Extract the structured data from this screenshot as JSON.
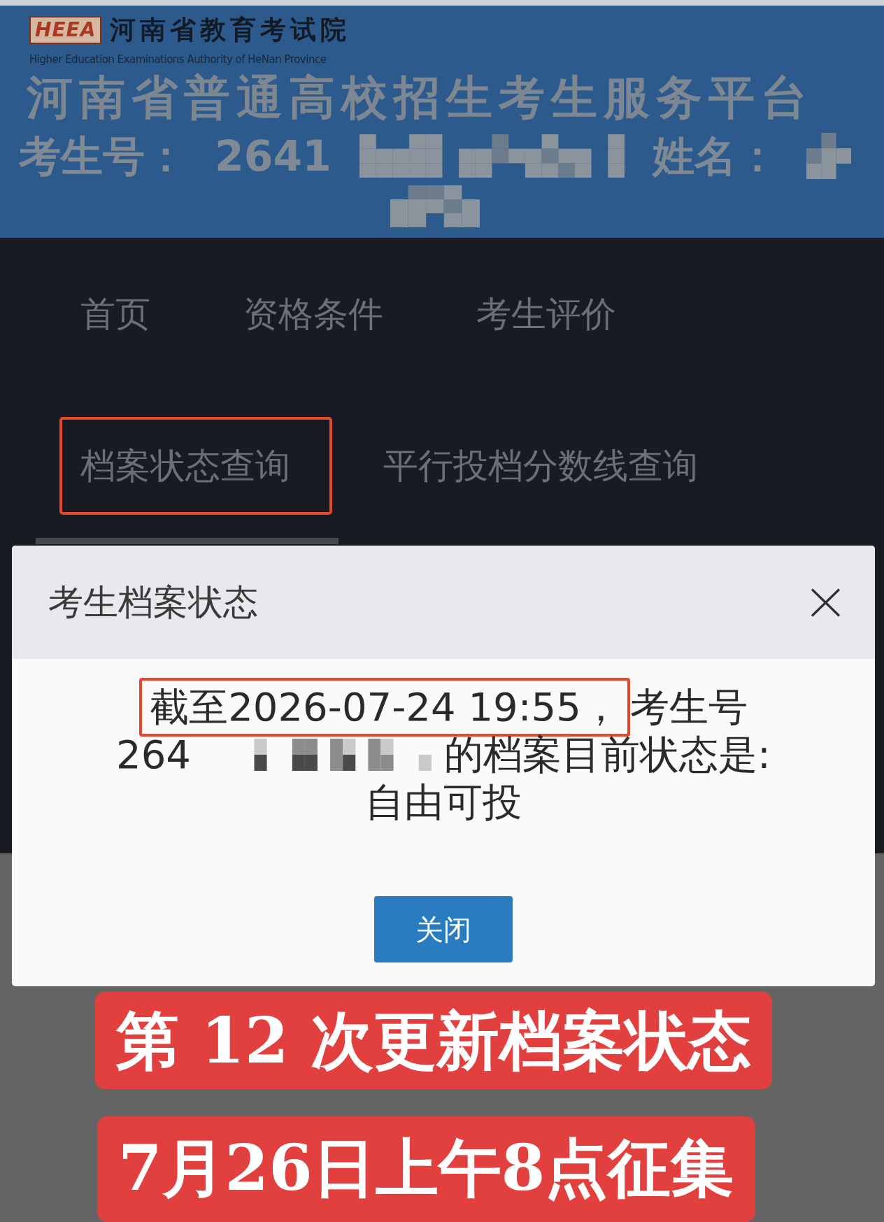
{
  "header": {
    "logo": "HEEA",
    "org_name": "河南省教育考试院",
    "org_name_en": "Higher Education Examinations Authority of HeNan Province",
    "title": "河南省普通高校招生考生服务平台",
    "info_lines": [
      [
        {
          "kind": "text",
          "text": "考生号："
        },
        {
          "kind": "text",
          "text": "2641"
        },
        {
          "kind": "redaction"
        },
        {
          "kind": "text",
          "text": "姓名："
        },
        {
          "kind": "redaction"
        }
      ],
      [
        {
          "kind": "redaction"
        }
      ]
    ]
  },
  "nav": {
    "items": [
      {
        "label": "首页",
        "selected": false,
        "annotated": false
      },
      {
        "label": "资格条件",
        "selected": false,
        "annotated": false
      },
      {
        "label": "考生评价",
        "selected": false,
        "annotated": false
      },
      {
        "label": "档案状态查询",
        "selected": true,
        "annotated": true
      },
      {
        "label": "平行投档分数线查询",
        "selected": false,
        "annotated": false
      }
    ]
  },
  "dialog": {
    "title": "考生档案状态",
    "message_lines": [
      [
        {
          "kind": "annotated",
          "text": "截至2026-07-24 19:55，"
        },
        {
          "kind": "text",
          "text": "考生号"
        }
      ],
      [
        {
          "kind": "text",
          "text": "264"
        },
        {
          "kind": "redaction"
        },
        {
          "kind": "text",
          "text": "的档案目前状态是:"
        }
      ],
      [
        {
          "kind": "text",
          "text": "自由可投"
        }
      ]
    ],
    "button": "关闭"
  },
  "captions": [
    "第 12 次更新档案状态",
    "7月26日上午8点征集"
  ]
}
